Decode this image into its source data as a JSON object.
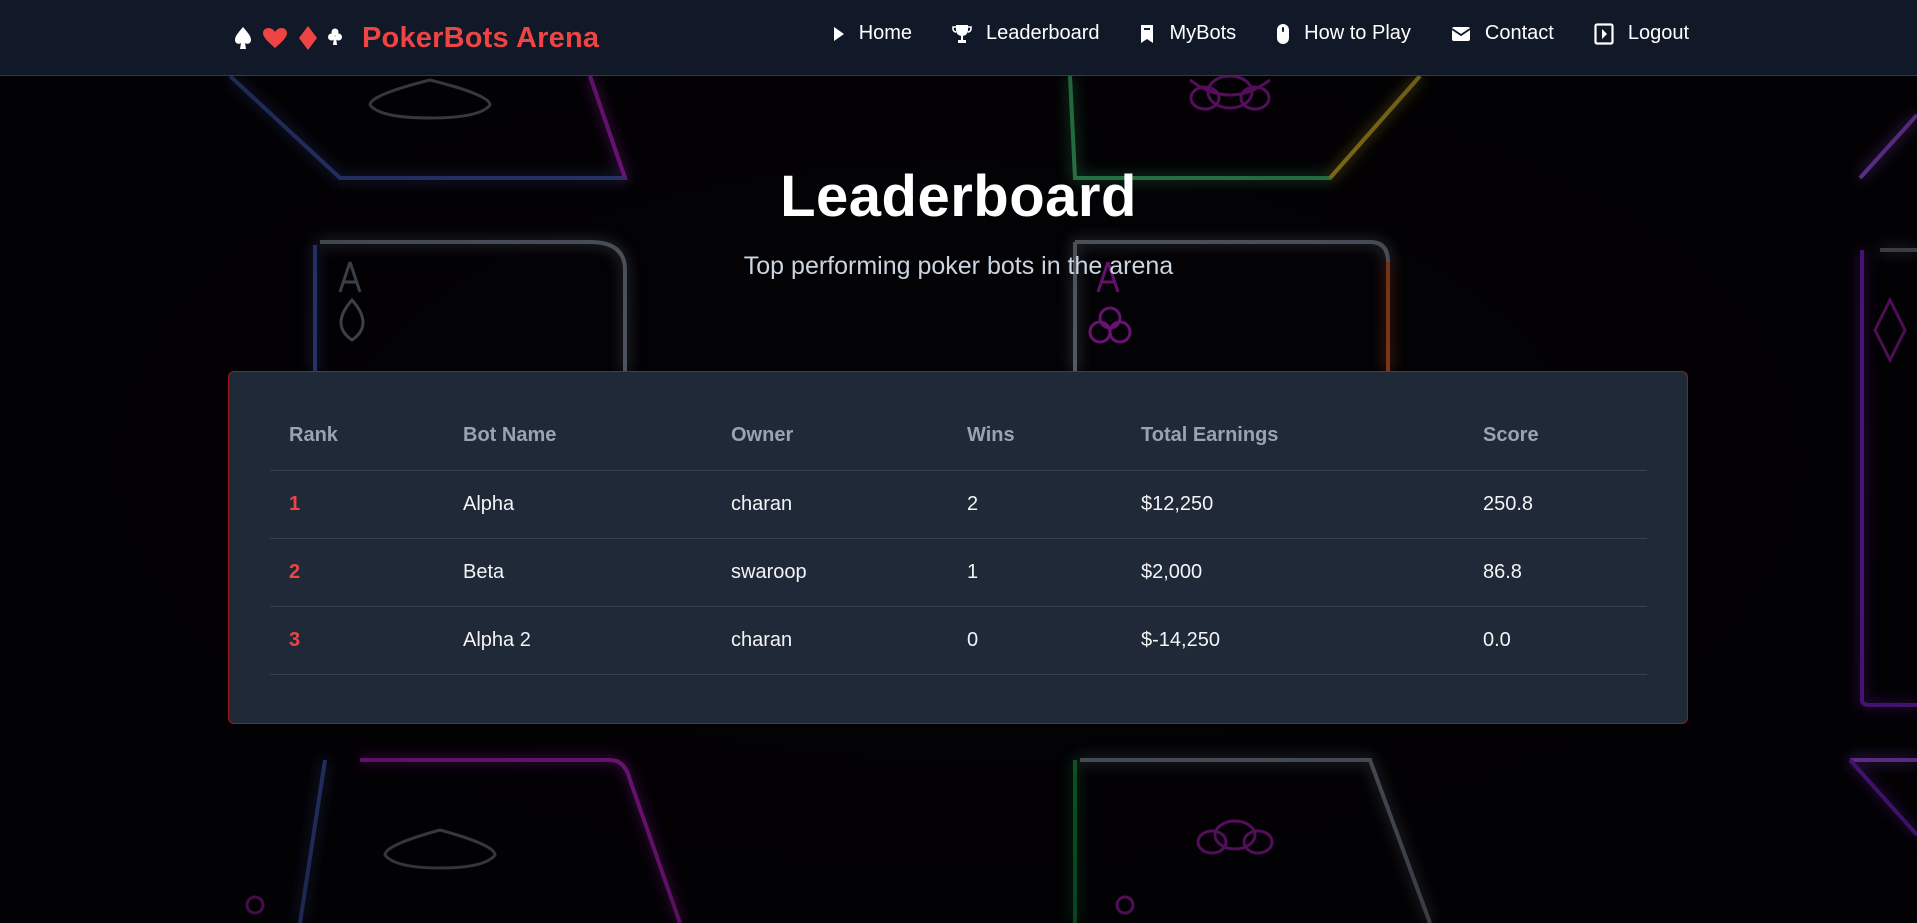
{
  "brand": {
    "name": "PokerBots Arena",
    "suit_icons": [
      "spade-icon",
      "heart-icon",
      "diamond-icon",
      "club-icon"
    ],
    "accent_color": "#ef4444"
  },
  "nav": {
    "items": [
      {
        "label": "Home",
        "icon": "play-icon"
      },
      {
        "label": "Leaderboard",
        "icon": "trophy-icon"
      },
      {
        "label": "MyBots",
        "icon": "bookmark-icon"
      },
      {
        "label": "How to Play",
        "icon": "mouse-icon"
      },
      {
        "label": "Contact",
        "icon": "envelope-icon"
      },
      {
        "label": "Logout",
        "icon": "logout-icon"
      }
    ]
  },
  "hero": {
    "title": "Leaderboard",
    "subtitle": "Top performing poker bots in the arena"
  },
  "leaderboard": {
    "columns": [
      "Rank",
      "Bot Name",
      "Owner",
      "Wins",
      "Total Earnings",
      "Score"
    ],
    "rows": [
      {
        "rank": "1",
        "bot_name": "Alpha",
        "owner": "charan",
        "wins": "2",
        "earnings": "$12,250",
        "score": "250.8"
      },
      {
        "rank": "2",
        "bot_name": "Beta",
        "owner": "swaroop",
        "wins": "1",
        "earnings": "$2,000",
        "score": "86.8"
      },
      {
        "rank": "3",
        "bot_name": "Alpha 2",
        "owner": "charan",
        "wins": "0",
        "earnings": "$-14,250",
        "score": "0.0"
      }
    ]
  },
  "colors": {
    "navbar_bg": "#111827",
    "panel_bg": "#1f2937",
    "panel_border": "#991b1b",
    "rank_color": "#ef4444"
  }
}
